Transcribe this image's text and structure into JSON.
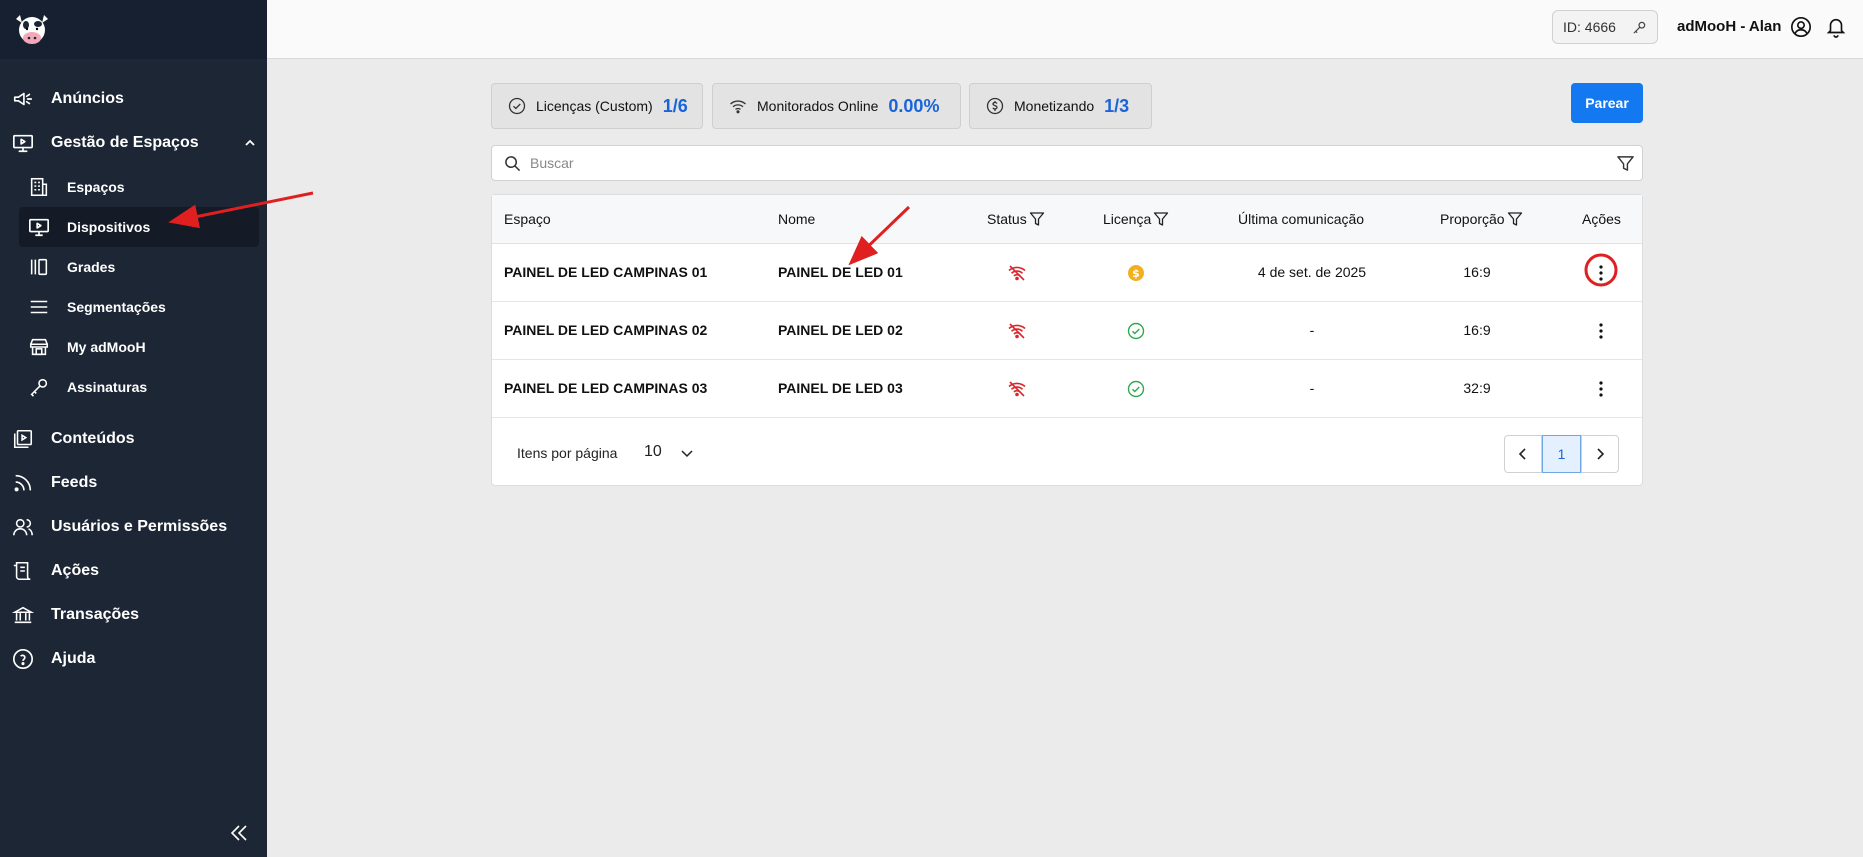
{
  "sidebar": {
    "items_top": [
      {
        "label": "Anúncios",
        "icon": "megaphone-icon"
      },
      {
        "label": "Gestão de Espaços",
        "icon": "monitor-play-icon"
      }
    ],
    "sub_items": [
      {
        "label": "Espaços",
        "icon": "building-icon"
      },
      {
        "label": "Dispositivos",
        "icon": "monitor-icon",
        "active": true
      },
      {
        "label": "Grades",
        "icon": "grid-icon"
      },
      {
        "label": "Segmentações",
        "icon": "menu-lines-icon"
      },
      {
        "label": "My adMooH",
        "icon": "store-icon"
      },
      {
        "label": "Assinaturas",
        "icon": "key-icon"
      }
    ],
    "items_bottom": [
      {
        "label": "Conteúdos",
        "icon": "media-library-icon"
      },
      {
        "label": "Feeds",
        "icon": "rss-icon"
      },
      {
        "label": "Usuários e Permissões",
        "icon": "users-icon"
      },
      {
        "label": "Ações",
        "icon": "scroll-icon"
      },
      {
        "label": "Transações",
        "icon": "bank-icon"
      },
      {
        "label": "Ajuda",
        "icon": "help-circle-icon"
      }
    ]
  },
  "topbar": {
    "id_label": "ID: 4666",
    "user_name": "adMooH - Alan"
  },
  "stats": [
    {
      "label": "Licenças (Custom)",
      "value": "1/6",
      "icon": "check-circle-icon"
    },
    {
      "label": "Monitorados Online",
      "value": "0.00%",
      "icon": "wifi-icon"
    },
    {
      "label": "Monetizando",
      "value": "1/3",
      "icon": "dollar-circle-icon"
    }
  ],
  "actions": {
    "pair_label": "Parear"
  },
  "search": {
    "placeholder": "Buscar"
  },
  "table": {
    "headers": {
      "space": "Espaço",
      "name": "Nome",
      "status": "Status",
      "license": "Licença",
      "last_comm": "Última comunicação",
      "ratio": "Proporção",
      "actions": "Ações"
    },
    "rows": [
      {
        "space": "PAINEL DE LED CAMPINAS 01",
        "name": "PAINEL DE LED 01",
        "status": "offline",
        "license": "monetizing",
        "last_comm": "4 de set. de 2025",
        "ratio": "16:9"
      },
      {
        "space": "PAINEL DE LED CAMPINAS 02",
        "name": "PAINEL DE LED 02",
        "status": "offline",
        "license": "active",
        "last_comm": "-",
        "ratio": "16:9"
      },
      {
        "space": "PAINEL DE LED CAMPINAS 03",
        "name": "PAINEL DE LED 03",
        "status": "offline",
        "license": "active",
        "last_comm": "-",
        "ratio": "32:9"
      }
    ]
  },
  "pagination": {
    "per_page_label": "Itens por página",
    "per_page": "10",
    "current_page": "1"
  },
  "colors": {
    "sidebar_bg": "#1d2634",
    "accent": "#1478f0",
    "stat_value": "#1a64d9",
    "offline": "#d9262b",
    "license_ok": "#2fa84f",
    "monetizing": "#f2b01e",
    "annotation": "#e02020"
  }
}
